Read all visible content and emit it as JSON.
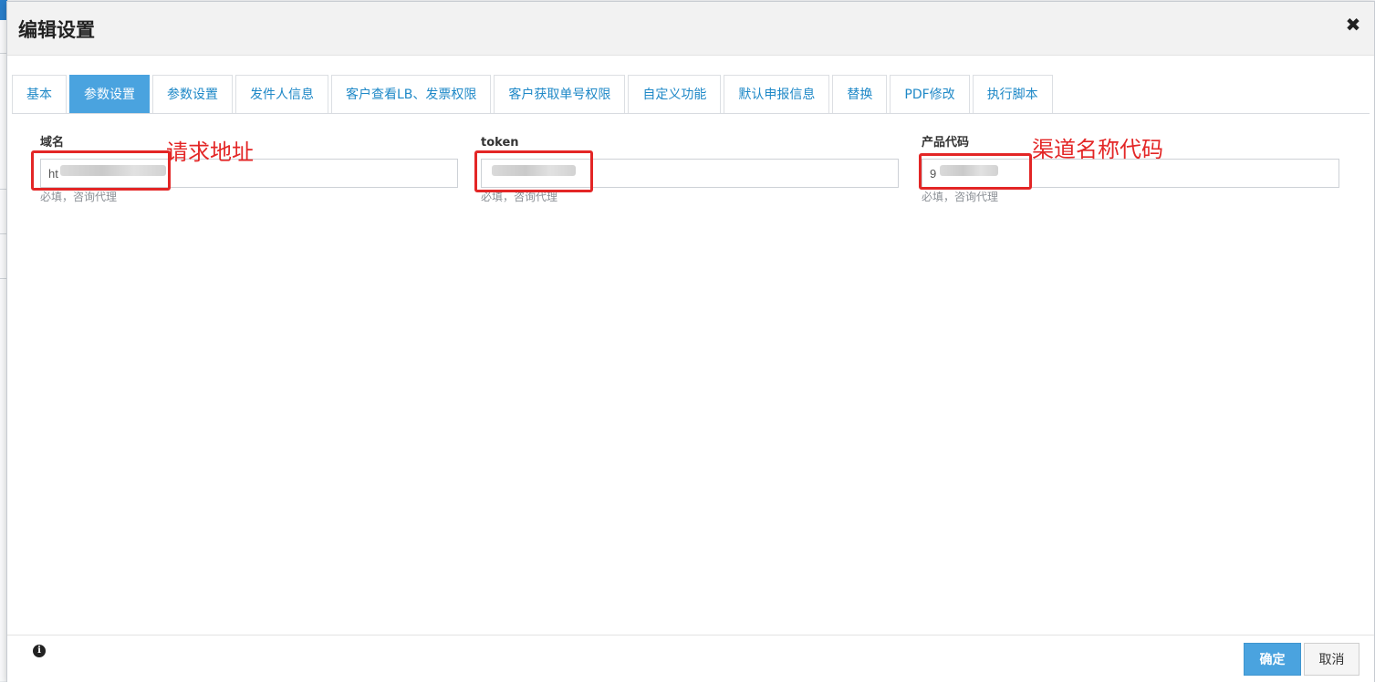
{
  "modal": {
    "title": "编辑设置",
    "close_glyph": "✖"
  },
  "tabs": [
    {
      "label": "基本",
      "active": false
    },
    {
      "label": "参数设置",
      "active": true
    },
    {
      "label": "参数设置",
      "active": false
    },
    {
      "label": "发件人信息",
      "active": false
    },
    {
      "label": "客户查看LB、发票权限",
      "active": false
    },
    {
      "label": "客户获取单号权限",
      "active": false
    },
    {
      "label": "自定义功能",
      "active": false
    },
    {
      "label": "默认申报信息",
      "active": false
    },
    {
      "label": "替换",
      "active": false
    },
    {
      "label": "PDF修改",
      "active": false
    },
    {
      "label": "执行脚本",
      "active": false
    }
  ],
  "fields": [
    {
      "label": "域名",
      "value": "ht",
      "help": "必填，咨询代理",
      "annotation": "请求地址"
    },
    {
      "label": "token",
      "value": "",
      "help": "必填，咨询代理",
      "annotation": ""
    },
    {
      "label": "产品代码",
      "value": "9",
      "help": "必填，咨询代理",
      "annotation": "渠道名称代码"
    }
  ],
  "footer": {
    "info_icon": "info-icon",
    "ok_label": "确定",
    "cancel_label": "取消"
  },
  "colors": {
    "accent": "#4aa3df",
    "tab_text": "#1e88c7",
    "annotation": "#e32626"
  }
}
